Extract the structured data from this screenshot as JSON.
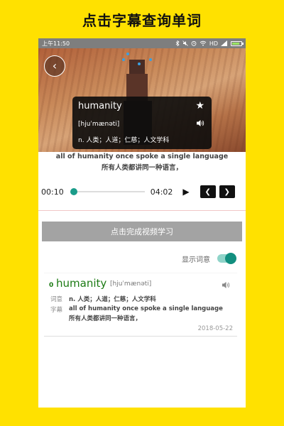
{
  "banner": {
    "title": "点击字幕查询单词"
  },
  "status_bar": {
    "time": "上午11:50",
    "network": "HD",
    "battery_level": 0.8,
    "battery_color": "#9be564",
    "icons": [
      "bluetooth-icon",
      "mute-icon",
      "alarm-icon",
      "wifi-icon",
      "signal-icon",
      "battery-icon"
    ]
  },
  "video": {
    "back_icon": "chevron-left-icon"
  },
  "word_popup": {
    "word": "humanity",
    "phonetic": "[hjuˈmænəti]",
    "definition": "n. 人类；人道；仁慈；人文学科",
    "star_icon": "star-icon",
    "speaker_icon": "speaker-icon"
  },
  "subtitle": {
    "english": "all of humanity once spoke a single language",
    "chinese": "所有人类都讲同一种语言，"
  },
  "player": {
    "current_time": "00:10",
    "total_time": "04:02",
    "progress": 0.04,
    "accent_color": "#16a085",
    "play_icon": "play-icon",
    "prev_icon": "chevron-left-icon",
    "next_icon": "chevron-right-icon"
  },
  "complete_button": {
    "label": "点击完成视频学习"
  },
  "show_words_toggle": {
    "label": "显示词意",
    "on": true
  },
  "vocab_card": {
    "index": "0",
    "word": "humanity",
    "phonetic": "[hjuˈmænəti]",
    "meaning_label": "词意",
    "meaning": "n. 人类；人道；仁慈；人文学科",
    "subtitle_label": "字幕",
    "subtitle_en": "all of humanity once spoke a single language",
    "subtitle_zh": "所有人类都讲同一种语言，",
    "date": "2018-05-22",
    "word_color": "#1b7a13"
  }
}
